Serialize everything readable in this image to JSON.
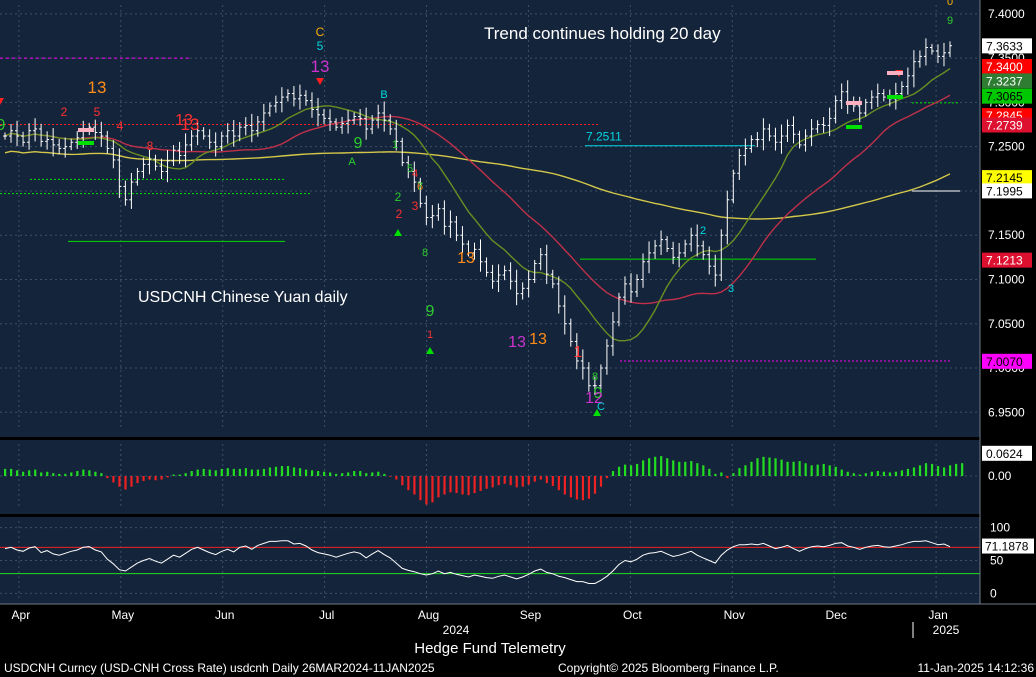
{
  "chart_data": [
    {
      "type": "candlestick",
      "title": "USDCNH Chinese Yuan daily",
      "annotation": "Trend continues holding 20 day",
      "ylim": [
        6.93,
        7.41
      ],
      "yticks": [
        "7.4000",
        "7.3500",
        "7.3000",
        "7.2500",
        "7.2000",
        "7.1500",
        "7.1000",
        "7.0500",
        "7.0000",
        "6.9500"
      ],
      "xticks": [
        "Apr",
        "May",
        "Jun",
        "Jul",
        "Aug",
        "Sep",
        "Oct",
        "Nov",
        "Dec",
        "Jan"
      ],
      "xlabel_years": [
        "2024",
        "2025"
      ],
      "closes": [
        7.262,
        7.268,
        7.262,
        7.255,
        7.268,
        7.27,
        7.256,
        7.258,
        7.252,
        7.248,
        7.25,
        7.255,
        7.26,
        7.268,
        7.272,
        7.266,
        7.262,
        7.248,
        7.235,
        7.205,
        7.19,
        7.21,
        7.222,
        7.23,
        7.236,
        7.228,
        7.222,
        7.234,
        7.246,
        7.24,
        7.252,
        7.262,
        7.268,
        7.262,
        7.255,
        7.25,
        7.262,
        7.268,
        7.262,
        7.272,
        7.274,
        7.268,
        7.278,
        7.288,
        7.296,
        7.3,
        7.306,
        7.31,
        7.304,
        7.308,
        7.302,
        7.292,
        7.286,
        7.282,
        7.278,
        7.272,
        7.276,
        7.28,
        7.284,
        7.282,
        7.27,
        7.28,
        7.288,
        7.28,
        7.27,
        7.256,
        7.232,
        7.222,
        7.21,
        7.186,
        7.17,
        7.172,
        7.18,
        7.16,
        7.165,
        7.15,
        7.14,
        7.13,
        7.134,
        7.12,
        7.108,
        7.098,
        7.105,
        7.11,
        7.098,
        7.084,
        7.09,
        7.1,
        7.118,
        7.128,
        7.106,
        7.095,
        7.07,
        7.05,
        7.03,
        7.008,
        7.0,
        6.98,
        6.98,
        7.0,
        7.025,
        7.052,
        7.08,
        7.095,
        7.086,
        7.1,
        7.12,
        7.13,
        7.138,
        7.145,
        7.135,
        7.125,
        7.13,
        7.14,
        7.15,
        7.138,
        7.128,
        7.115,
        7.105,
        7.15,
        7.19,
        7.22,
        7.24,
        7.248,
        7.258,
        7.258,
        7.27,
        7.262,
        7.255,
        7.262,
        7.274,
        7.264,
        7.252,
        7.262,
        7.27,
        7.275,
        7.274,
        7.282,
        7.302,
        7.312,
        7.3,
        7.296,
        7.288,
        7.3,
        7.306,
        7.31,
        7.306,
        7.304,
        7.31,
        7.318,
        7.33,
        7.346,
        7.352,
        7.362,
        7.358,
        7.352,
        7.356,
        7.364
      ],
      "bar_annotations": [
        "5",
        "13",
        "9",
        "2",
        "4",
        "13",
        "8",
        "C",
        "5",
        "13",
        "B",
        "9",
        "A",
        "1",
        "2",
        "3",
        "4",
        "5",
        "6",
        "7",
        "2",
        "8",
        "9",
        "13",
        "13",
        "13",
        "13",
        "1",
        "8",
        "9",
        "12",
        "C",
        "1",
        "2",
        "3",
        "9",
        "0"
      ],
      "levels": [
        "7.2511"
      ],
      "right_labels": [
        {
          "value": "7.3633",
          "bg": "#ffffff",
          "fg": "#000000"
        },
        {
          "value": "7.3400",
          "bg": "#ff0000",
          "fg": "#ffffff"
        },
        {
          "value": "7.3237",
          "bg": "#2e7d32",
          "fg": "#ffffff"
        },
        {
          "value": "7.3065",
          "bg": "#00c800",
          "fg": "#000000"
        },
        {
          "value": "7.2845",
          "bg": "#ff0000",
          "fg": "#ffffff"
        },
        {
          "value": "7.2739",
          "bg": "#dd1030",
          "fg": "#ffffff"
        },
        {
          "value": "7.2145",
          "bg": "#ffff00",
          "fg": "#000000"
        },
        {
          "value": "7.1995",
          "bg": "#ffffff",
          "fg": "#000000"
        },
        {
          "value": "7.1213",
          "bg": "#dd1030",
          "fg": "#ffffff"
        },
        {
          "value": "7.0070",
          "bg": "#ff00ff",
          "fg": "#000000"
        }
      ],
      "moving_averages": [
        {
          "period": 20,
          "color": "#6b8e23"
        },
        {
          "period": 50,
          "color": "#c0304a"
        },
        {
          "period": 200,
          "color": "#d4c84a"
        }
      ]
    },
    {
      "type": "bar",
      "title": "",
      "ylim": [
        -0.09,
        0.09
      ],
      "yticks": [
        "0.00"
      ],
      "last_value": "0.0624",
      "values": [
        0.02,
        0.02,
        0.016,
        0.012,
        0.016,
        0.018,
        0.01,
        0.012,
        0.008,
        0.006,
        0.006,
        0.01,
        0.014,
        0.018,
        0.016,
        0.012,
        0.008,
        -0.006,
        -0.018,
        -0.03,
        -0.038,
        -0.03,
        -0.02,
        -0.014,
        -0.01,
        -0.012,
        -0.01,
        -0.004,
        0.004,
        0.004,
        0.008,
        0.014,
        0.018,
        0.02,
        0.018,
        0.016,
        0.02,
        0.022,
        0.02,
        0.02,
        0.022,
        0.018,
        0.018,
        0.02,
        0.024,
        0.026,
        0.028,
        0.028,
        0.024,
        0.022,
        0.018,
        0.016,
        0.014,
        0.012,
        0.01,
        0.006,
        0.008,
        0.01,
        0.014,
        0.014,
        0.008,
        0.01,
        0.012,
        0.006,
        -0.002,
        -0.01,
        -0.026,
        -0.04,
        -0.052,
        -0.068,
        -0.08,
        -0.074,
        -0.06,
        -0.052,
        -0.046,
        -0.048,
        -0.052,
        -0.054,
        -0.048,
        -0.042,
        -0.036,
        -0.032,
        -0.026,
        -0.022,
        -0.026,
        -0.032,
        -0.03,
        -0.024,
        -0.016,
        -0.01,
        -0.02,
        -0.028,
        -0.04,
        -0.052,
        -0.06,
        -0.066,
        -0.068,
        -0.064,
        -0.05,
        -0.03,
        -0.006,
        0.014,
        0.026,
        0.032,
        0.03,
        0.034,
        0.044,
        0.05,
        0.054,
        0.056,
        0.05,
        0.044,
        0.04,
        0.04,
        0.042,
        0.036,
        0.03,
        0.02,
        0.006,
        0.01,
        -0.006,
        0.008,
        0.022,
        0.03,
        0.04,
        0.05,
        0.054,
        0.052,
        0.05,
        0.046,
        0.04,
        0.04,
        0.042,
        0.036,
        0.03,
        0.032,
        0.034,
        0.03,
        0.026,
        0.018,
        0.012,
        0.008,
        0.004,
        0.008,
        0.012,
        0.014,
        0.012,
        0.01,
        0.012,
        0.016,
        0.02,
        0.024,
        0.03,
        0.036,
        0.034,
        0.028,
        0.024,
        0.03,
        0.034,
        0.036
      ]
    },
    {
      "type": "line",
      "title": "",
      "ylim": [
        -10,
        110
      ],
      "yticks": [
        "100",
        "50",
        "0"
      ],
      "hlines": [
        70,
        30
      ],
      "last_value": "71.1878",
      "values": [
        68,
        70,
        66,
        64,
        69,
        71,
        62,
        65,
        60,
        58,
        61,
        64,
        66,
        70,
        71,
        66,
        63,
        52,
        45,
        36,
        34,
        40,
        46,
        50,
        53,
        49,
        46,
        52,
        58,
        55,
        61,
        67,
        70,
        66,
        62,
        59,
        64,
        67,
        63,
        70,
        72,
        67,
        73,
        76,
        79,
        79,
        80,
        80,
        75,
        76,
        72,
        66,
        62,
        60,
        58,
        55,
        58,
        61,
        63,
        61,
        54,
        60,
        65,
        59,
        54,
        46,
        38,
        35,
        33,
        30,
        28,
        30,
        34,
        30,
        32,
        29,
        27,
        25,
        28,
        26,
        24,
        23,
        26,
        28,
        25,
        22,
        25,
        29,
        34,
        37,
        32,
        30,
        26,
        24,
        21,
        18,
        18,
        15,
        15,
        20,
        26,
        34,
        44,
        50,
        48,
        52,
        58,
        61,
        62,
        64,
        60,
        56,
        58,
        61,
        64,
        58,
        54,
        50,
        46,
        58,
        66,
        71,
        74,
        74,
        75,
        74,
        76,
        72,
        68,
        70,
        73,
        68,
        64,
        68,
        71,
        72,
        71,
        73,
        76,
        77,
        72,
        70,
        67,
        70,
        72,
        73,
        71,
        70,
        72,
        74,
        77,
        79,
        79,
        80,
        77,
        74,
        75,
        71
      ]
    }
  ],
  "footer": {
    "title": "Hedge Fund Telemetry",
    "left": "USDCNH Curncy (USD-CNH Cross Rate) usdcnh  Daily 26MAR2024-11JAN2025",
    "copyright": "Copyright© 2025 Bloomberg Finance L.P.",
    "date": "11-Jan-2025 14:12:36"
  }
}
